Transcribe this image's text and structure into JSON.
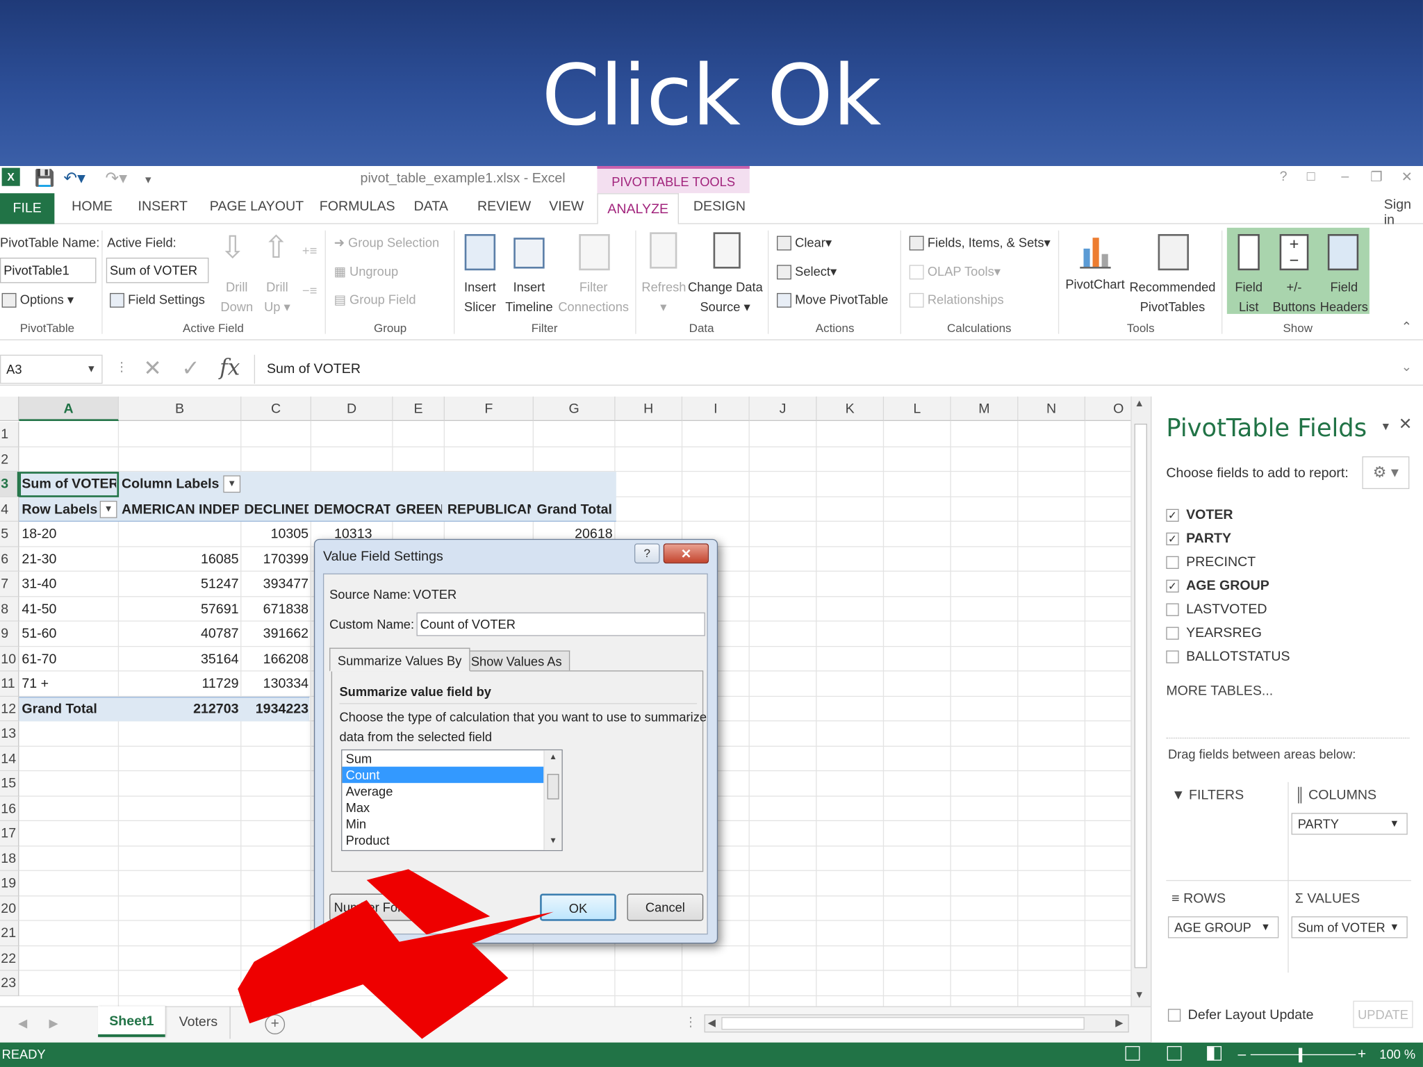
{
  "banner": {
    "title": "Click Ok"
  },
  "window": {
    "doc_title": "pivot_table_example1.xlsx - Excel",
    "contextual_group": "PIVOTTABLE TOOLS",
    "sign_in": "Sign in",
    "help": "?"
  },
  "tabs": [
    "FILE",
    "HOME",
    "INSERT",
    "PAGE LAYOUT",
    "FORMULAS",
    "DATA",
    "REVIEW",
    "VIEW",
    "ANALYZE",
    "DESIGN"
  ],
  "ribbon": {
    "pivottable": {
      "name_label": "PivotTable Name:",
      "name_value": "PivotTable1",
      "options": "Options",
      "group": "PivotTable"
    },
    "active_field": {
      "label": "Active Field:",
      "value": "Sum of VOTER",
      "field_settings": "Field Settings",
      "drill_down": [
        "Drill",
        "Down"
      ],
      "drill_up": [
        "Drill",
        "Up"
      ],
      "group": "Active Field"
    },
    "group": {
      "group_selection": "Group Selection",
      "ungroup": "Ungroup",
      "group_field": "Group Field",
      "group": "Group"
    },
    "filter": {
      "insert_slicer": [
        "Insert",
        "Slicer"
      ],
      "insert_timeline": [
        "Insert",
        "Timeline"
      ],
      "filter_connections": [
        "Filter",
        "Connections"
      ],
      "group": "Filter"
    },
    "data": {
      "refresh": "Refresh",
      "change_source": [
        "Change Data",
        "Source"
      ],
      "group": "Data"
    },
    "actions": {
      "clear": "Clear",
      "select": "Select",
      "move": "Move PivotTable",
      "group": "Actions"
    },
    "calculations": {
      "fields_items": "Fields, Items, & Sets",
      "olap": "OLAP Tools",
      "relationships": "Relationships",
      "group": "Calculations"
    },
    "tools": {
      "pivotchart": "PivotChart",
      "recommended": [
        "Recommended",
        "PivotTables"
      ],
      "group": "Tools"
    },
    "show": {
      "field_list": [
        "Field",
        "List"
      ],
      "buttons": [
        "+/-",
        "Buttons"
      ],
      "headers": [
        "Field",
        "Headers"
      ],
      "group": "Show"
    }
  },
  "formula_bar": {
    "name_box": "A3",
    "fx": "fx",
    "content": "Sum of VOTER"
  },
  "sheet": {
    "columns": [
      "A",
      "B",
      "C",
      "D",
      "E",
      "F",
      "G",
      "H",
      "I",
      "J",
      "K",
      "L",
      "M",
      "N",
      "O"
    ],
    "rows": [
      "1",
      "2",
      "3",
      "4",
      "5",
      "6",
      "7",
      "8",
      "9",
      "10",
      "11",
      "12",
      "13",
      "14",
      "15",
      "16",
      "17",
      "18",
      "19",
      "20",
      "21",
      "22",
      "23"
    ],
    "r3": {
      "a": "Sum of VOTER",
      "b": "Column Labels"
    },
    "r4": [
      "Row Labels",
      "AMERICAN INDEP",
      "DECLINED",
      "DEMOCRAT",
      "GREEN",
      "REPUBLICAN",
      "Grand Total"
    ],
    "r5": {
      "a": "18-20",
      "c": "10305",
      "d": "10313",
      "g": "20618"
    },
    "data_rows": [
      {
        "a": "21-30",
        "b": "16085",
        "c": "170399"
      },
      {
        "a": "31-40",
        "b": "51247",
        "c": "393477"
      },
      {
        "a": "41-50",
        "b": "57691",
        "c": "671838"
      },
      {
        "a": "51-60",
        "b": "40787",
        "c": "391662"
      },
      {
        "a": "61-70",
        "b": "35164",
        "c": "166208"
      },
      {
        "a": "71 +",
        "b": "11729",
        "c": "130334"
      }
    ],
    "grand": {
      "a": "Grand Total",
      "b": "212703",
      "c": "1934223"
    }
  },
  "sheet_tabs": [
    "Sheet1",
    "Voters"
  ],
  "status": {
    "ready": "READY",
    "zoom": "100 %"
  },
  "pane": {
    "title": "PivotTable Fields",
    "choose": "Choose fields to add to report:",
    "fields": [
      {
        "name": "VOTER",
        "checked": true
      },
      {
        "name": "PARTY",
        "checked": true
      },
      {
        "name": "PRECINCT",
        "checked": false
      },
      {
        "name": "AGE GROUP",
        "checked": true
      },
      {
        "name": "LASTVOTED",
        "checked": false
      },
      {
        "name": "YEARSREG",
        "checked": false
      },
      {
        "name": "BALLOTSTATUS",
        "checked": false
      }
    ],
    "more": "MORE TABLES...",
    "drag": "Drag fields between areas below:",
    "filters": "FILTERS",
    "columns": "COLUMNS",
    "rows": "ROWS",
    "values": "VALUES",
    "columns_item": "PARTY",
    "rows_item": "AGE GROUP",
    "values_item": "Sum of VOTER",
    "defer": "Defer Layout Update",
    "update": "UPDATE"
  },
  "dialog": {
    "title": "Value Field Settings",
    "source_label": "Source Name:",
    "source_value": "VOTER",
    "custom_label": "Custom Name:",
    "custom_value": "Count of VOTER",
    "tab_summarize": "Summarize Values By",
    "tab_show": "Show Values As",
    "section": "Summarize value field by",
    "desc1": "Choose the type of calculation that you want to use to summarize",
    "desc2": "data from the selected field",
    "list": [
      "Sum",
      "Count",
      "Average",
      "Max",
      "Min",
      "Product"
    ],
    "selected": "Count",
    "number_format": "Number Format",
    "ok": "OK",
    "cancel": "Cancel"
  },
  "colors": {
    "excel_green": "#217346",
    "analyze": "#a1237c",
    "banner": "#2d4f98",
    "arrow": "#ee0000",
    "selection": "#3399ff"
  }
}
